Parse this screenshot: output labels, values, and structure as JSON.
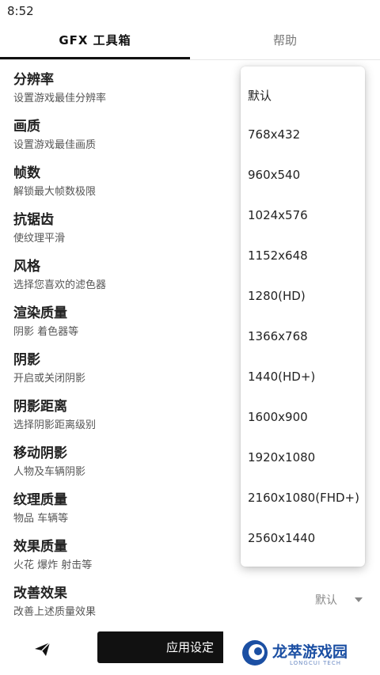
{
  "status_bar": {
    "time": "8:52"
  },
  "tabs": [
    {
      "label": "GFX 工具箱",
      "active": true
    },
    {
      "label": "帮助",
      "active": false
    }
  ],
  "settings": [
    {
      "title": "分辨率",
      "desc": "设置游戏最佳分辨率"
    },
    {
      "title": "画质",
      "desc": "设置游戏最佳画质"
    },
    {
      "title": "帧数",
      "desc": "解锁最大帧数极限"
    },
    {
      "title": "抗锯齿",
      "desc": "使纹理平滑"
    },
    {
      "title": "风格",
      "desc": "选择您喜欢的滤色器"
    },
    {
      "title": "渲染质量",
      "desc": "阴影 着色器等"
    },
    {
      "title": "阴影",
      "desc": "开启或关闭阴影"
    },
    {
      "title": "阴影距离",
      "desc": "选择阴影距离级别"
    },
    {
      "title": "移动阴影",
      "desc": "人物及车辆阴影"
    },
    {
      "title": "纹理质量",
      "desc": "物品 车辆等"
    },
    {
      "title": "效果质量",
      "desc": "火花 爆炸 射击等"
    },
    {
      "title": "改善效果",
      "desc": "改善上述质量效果"
    }
  ],
  "improve_effect_select": {
    "value": "默认"
  },
  "dropdown": {
    "options": [
      "默认",
      "768x432",
      "960x540",
      "1024x576",
      "1152x648",
      "1280(HD)",
      "1366x768",
      "1440(HD+)",
      "1600x900",
      "1920x1080",
      "2160x1080(FHD+)",
      "2560x1440"
    ]
  },
  "bottom": {
    "apply_label": "应用设定",
    "send_icon": "send-icon"
  },
  "watermark": {
    "text": "龙萃游戏园",
    "sub": "LONGCUI TECH"
  },
  "colors": {
    "accent": "#111111",
    "watermark_blue": "#1b4fa3"
  }
}
